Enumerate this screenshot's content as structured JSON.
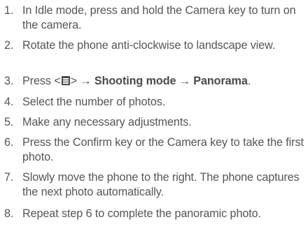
{
  "steps": [
    {
      "num": "1.",
      "text": "In Idle mode, press and hold the Camera key to turn on the camera."
    },
    {
      "num": "2.",
      "text": "Rotate the phone anti-clockwise to landscape view."
    },
    {
      "num": "3.",
      "pre": "Press <",
      "post": "> → ",
      "menu1": "Shooting mode",
      "arrow": " → ",
      "menu2": "Panorama",
      "end": ".",
      "icon": "menu-key-icon"
    },
    {
      "num": "4.",
      "text": "Select the number of photos."
    },
    {
      "num": "5.",
      "text": "Make any necessary adjustments."
    },
    {
      "num": "6.",
      "text": "Press the Confirm key or the Camera key to take the first photo."
    },
    {
      "num": "7.",
      "text": "Slowly move the phone to the right. The phone captures the next photo automatically."
    },
    {
      "num": "8.",
      "text": "Repeat step 6 to complete the panoramic photo."
    }
  ]
}
